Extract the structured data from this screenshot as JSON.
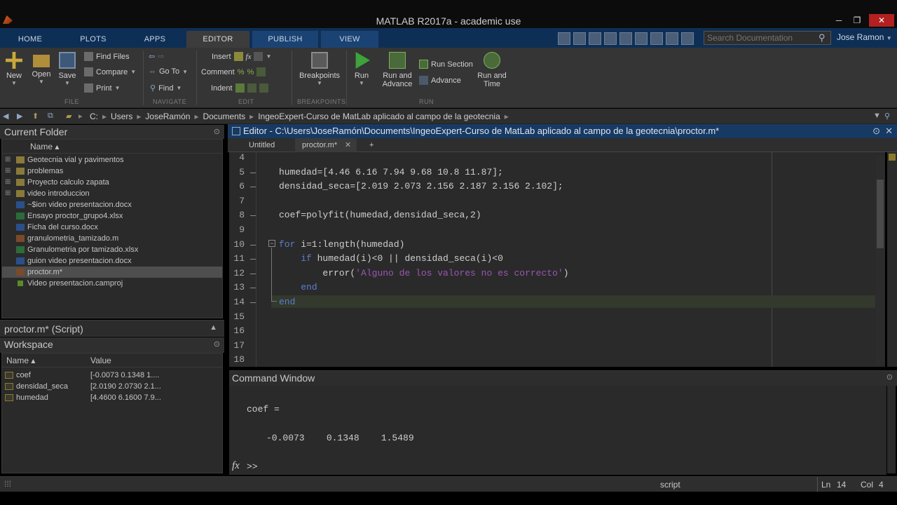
{
  "window": {
    "title": "MATLAB R2017a - academic use",
    "minimize": "─",
    "restore": "❐",
    "close": "✕"
  },
  "ribbon_tabs": [
    {
      "label": "HOME"
    },
    {
      "label": "PLOTS"
    },
    {
      "label": "APPS"
    },
    {
      "label": "EDITOR",
      "active": true
    },
    {
      "label": "PUBLISH"
    },
    {
      "label": "VIEW"
    }
  ],
  "search": {
    "placeholder": "Search Documentation"
  },
  "user": {
    "name": "Jose Ramon"
  },
  "ribbon": {
    "file": {
      "new": "New",
      "open": "Open",
      "save": "Save",
      "find_files": "Find Files",
      "compare": "Compare",
      "print": "Print",
      "group": "FILE"
    },
    "navigate": {
      "go_to": "Go To",
      "find": "Find",
      "group": "NAVIGATE"
    },
    "edit": {
      "insert": "Insert",
      "comment": "Comment",
      "indent": "Indent",
      "group": "EDIT"
    },
    "breakpoints": {
      "label": "Breakpoints",
      "group": "BREAKPOINTS"
    },
    "run": {
      "run": "Run",
      "run_advance_1": "Run and",
      "run_advance_2": "Advance",
      "run_section": "Run Section",
      "advance": "Advance",
      "run_time_1": "Run and",
      "run_time_2": "Time",
      "group": "RUN"
    }
  },
  "path": {
    "crumbs": [
      "C:",
      "Users",
      "JoseRamón",
      "Documents",
      "IngeoExpert-Curso de MatLab aplicado al campo de la geotecnia"
    ],
    "sep": "▸"
  },
  "current_folder": {
    "title": "Current Folder",
    "column": "Name ▴",
    "items": [
      {
        "name": "Geotecnia vial y pavimentos",
        "type": "folder"
      },
      {
        "name": "problemas",
        "type": "folder"
      },
      {
        "name": "Proyecto calculo zapata",
        "type": "folder"
      },
      {
        "name": "video introduccion",
        "type": "folder"
      },
      {
        "name": "~$ion video presentacion.docx",
        "type": "word"
      },
      {
        "name": "Ensayo proctor_grupo4.xlsx",
        "type": "excel"
      },
      {
        "name": "Ficha del curso.docx",
        "type": "word"
      },
      {
        "name": "granulometria_tamizado.m",
        "type": "mfile"
      },
      {
        "name": "Granulometria por tamizado.xlsx",
        "type": "excel"
      },
      {
        "name": "guion video presentacion.docx",
        "type": "word"
      },
      {
        "name": "proctor.m*",
        "type": "mfile",
        "selected": true
      },
      {
        "name": "Video presentacion.camproj",
        "type": "proj"
      }
    ]
  },
  "details": {
    "title": "proctor.m* (Script)"
  },
  "workspace": {
    "title": "Workspace",
    "col_name": "Name ▴",
    "col_value": "Value",
    "rows": [
      {
        "name": "coef",
        "value": "[-0.0073 0.1348 1...."
      },
      {
        "name": "densidad_seca",
        "value": "[2.0190 2.0730 2.1..."
      },
      {
        "name": "humedad",
        "value": "[4.4600 6.1600 7.9..."
      }
    ]
  },
  "editor": {
    "title": "Editor - C:\\Users\\JoseRamón\\Documents\\IngeoExpert-Curso de MatLab aplicado al campo de la geotecnia\\proctor.m*",
    "tabs": [
      {
        "label": "Untitled"
      },
      {
        "label": "proctor.m*",
        "active": true
      }
    ],
    "add_tab": "+",
    "lines": [
      {
        "n": "4",
        "code": ""
      },
      {
        "n": "5",
        "code": "humedad=[4.46 6.16 7.94 9.68 10.8 11.87];"
      },
      {
        "n": "6",
        "code": "densidad_seca=[2.019 2.073 2.156 2.187 2.156 2.102];"
      },
      {
        "n": "7",
        "code": ""
      },
      {
        "n": "8",
        "code": "coef=polyfit(humedad,densidad_seca,2)"
      },
      {
        "n": "9",
        "code": ""
      },
      {
        "n": "10",
        "kw": "for",
        "code": " i=1:length(humedad)"
      },
      {
        "n": "11",
        "indent": "    ",
        "kw": "if",
        "code": " humedad(i)<0 || densidad_seca(i)<0"
      },
      {
        "n": "12",
        "indent": "        ",
        "pre": "error(",
        "str": "'Alguno de los valores no es correcto'",
        "post": ")"
      },
      {
        "n": "13",
        "indent": "    ",
        "kw": "end",
        "code": ""
      },
      {
        "n": "14",
        "kw": "end",
        "code": ""
      },
      {
        "n": "15",
        "code": ""
      },
      {
        "n": "16",
        "code": ""
      },
      {
        "n": "17",
        "code": ""
      },
      {
        "n": "18",
        "code": ""
      }
    ]
  },
  "command_window": {
    "title": "Command Window",
    "output_label": "coef =",
    "output_values": "-0.0073    0.1348    1.5489",
    "prompt": ">>",
    "fx": "fx"
  },
  "status": {
    "mode": "script",
    "ln_label": "Ln",
    "ln": "14",
    "col_label": "Col",
    "col": "4"
  }
}
